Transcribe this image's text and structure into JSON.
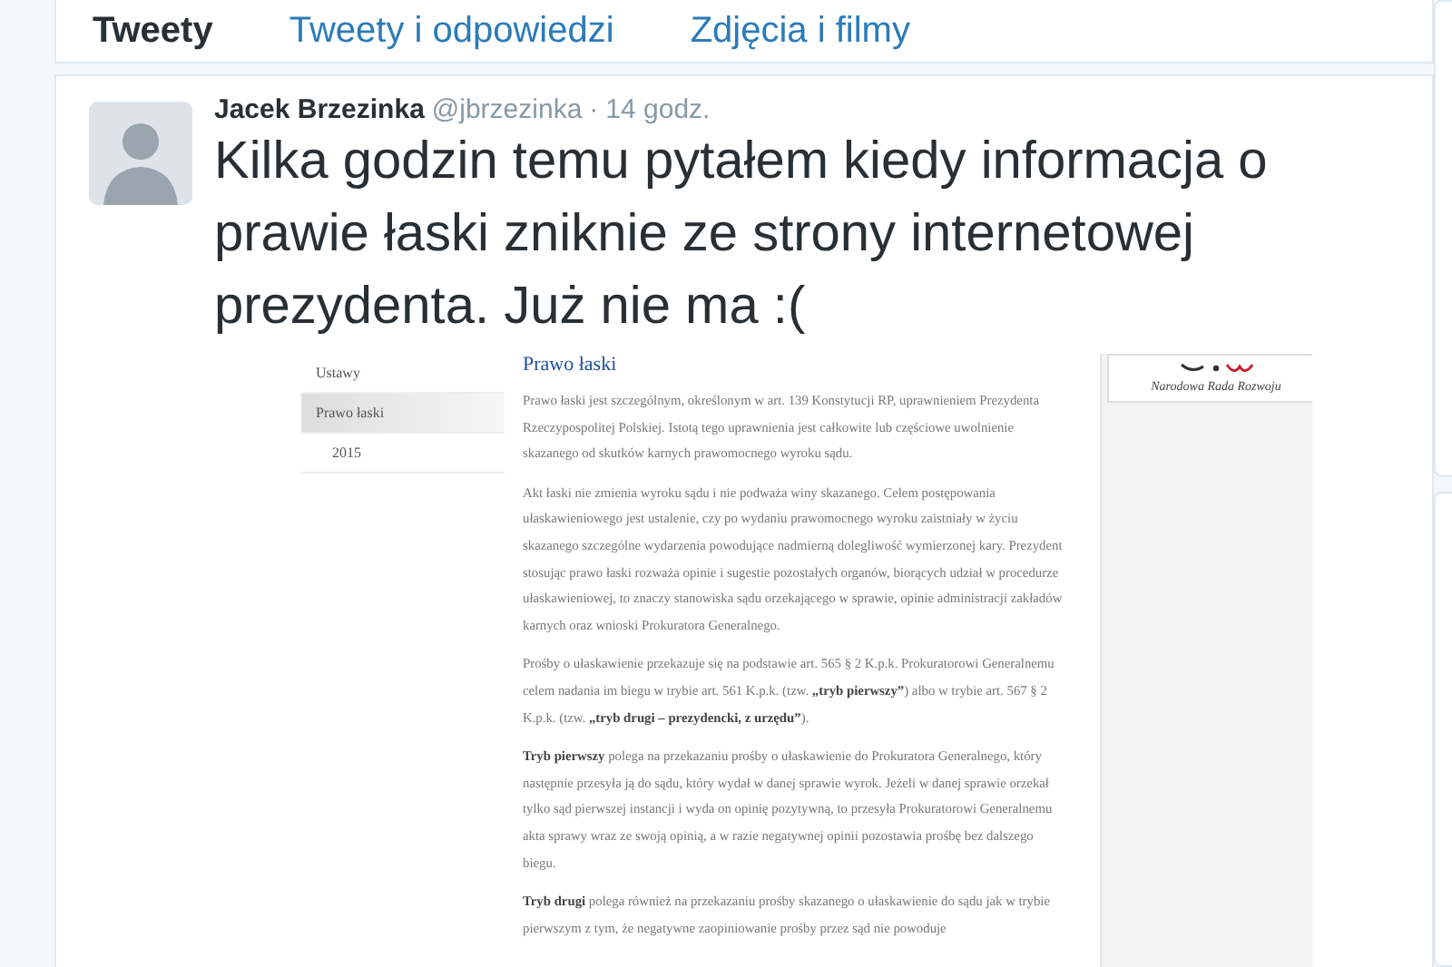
{
  "tabs": [
    {
      "label": "Tweety",
      "selected": true
    },
    {
      "label": "Tweety i odpowiedzi",
      "selected": false
    },
    {
      "label": "Zdjęcia i filmy",
      "selected": false
    }
  ],
  "tweet": {
    "author": "Jacek Brzezinka",
    "handle": "@jbrzezinka",
    "time": "14 godz.",
    "separator": "·",
    "text": "Kilka godzin temu pytałem kiedy informacja o prawie łaski zniknie ze strony internetowej prezydenta. Już nie ma :(",
    "attached_page": {
      "nav": [
        {
          "label": "Ustawy",
          "selected": false
        },
        {
          "label": "Prawo łaski",
          "selected": true,
          "children": [
            {
              "label": "2015",
              "selected": false
            }
          ]
        }
      ],
      "title": "Prawo łaski",
      "paragraphs": [
        "Prawo łaski jest szczególnym, określonym w art. 139 Konstytucji RP, uprawnieniem Prezydenta Rzeczypospolitej Polskiej. Istotą tego uprawnienia jest całkowite lub częściowe uwolnienie skazanego od skutków karnych prawomocnego wyroku sądu.",
        "Akt łaski nie zmienia wyroku sądu i nie podważa winy skazanego. Celem postępowania ułaskawieniowego jest ustalenie, czy po wydaniu prawomocnego wyroku zaistniały w życiu skazanego szczególne wydarzenia powodujące nadmierną dolegliwość wymierzonej kary. Prezydent stosując prawo łaski rozważa opinie i sugestie pozostałych organów, biorących udział w procedurze ułaskawieniowej, to znaczy stanowiska sądu orzekającego w sprawie, opinie administracji zakładów karnych oraz wnioski Prokuratora Generalnego.",
        "Prośby o ułaskawienie przekazuje się na podstawie art. 565 § 2 K.p.k. Prokuratorowi Generalnemu celem nadania im biegu w trybie art. 561 K.p.k. (tzw. **„tryb pierwszy”**) albo w trybie art. 567 § 2 K.p.k. (tzw. **„tryb drugi – prezydencki, z urzędu”**).",
        "**Tryb pierwszy** polega na przekazaniu prośby o ułaskawienie do Prokuratora Generalnego, który następnie przesyła ją do sądu, który wydał w danej sprawie wyrok. Jeżeli w danej sprawie orzekał tylko sąd pierwszej instancji i wyda on opinię pozytywną, to przesyła Prokuratorowi Generalnemu akta sprawy wraz ze swoją opinią, a w razie negatywnej opinii pozostawia prośbę bez dalszego biegu.",
        "**Tryb drugi** polega również na przekazaniu prośby skazanego o ułaskawienie do sądu jak w trybie pierwszym z tym, że negatywne zaopiniowanie prośby przez sąd nie powoduje"
      ],
      "logo_caption": "Narodowa Rada Rozwoju"
    }
  }
}
